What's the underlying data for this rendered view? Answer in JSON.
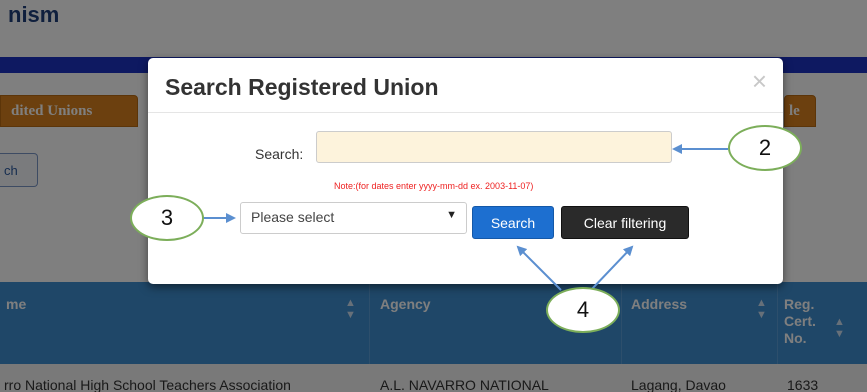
{
  "background": {
    "page_title_fragment": "nism",
    "tab_left": "dited Unions",
    "tab_right": "le",
    "search_button_fragment": "ch",
    "table": {
      "headers": [
        "me",
        "Agency",
        "Address",
        "Reg. Cert. No."
      ],
      "row": [
        "rro National High School Teachers Association",
        "A.L. NAVARRO NATIONAL",
        "Lagang, Davao",
        "1633"
      ]
    }
  },
  "modal": {
    "title": "Search Registered Union",
    "close": "×",
    "search_label": "Search:",
    "search_value": "",
    "note": "Note:(for dates enter yyyy-mm-dd ex. 2003-11-07)",
    "select_value": "Please select",
    "search_button": "Search",
    "clear_button": "Clear filtering"
  },
  "callouts": [
    "2",
    "3",
    "4"
  ],
  "colors": {
    "callout_border": "#7cae5a",
    "arrow": "#5b8fd0",
    "search_button": "#1d6fd0",
    "clear_button": "#2a2a2a",
    "input_bg": "#fdf3dc",
    "note": "#e22222"
  }
}
